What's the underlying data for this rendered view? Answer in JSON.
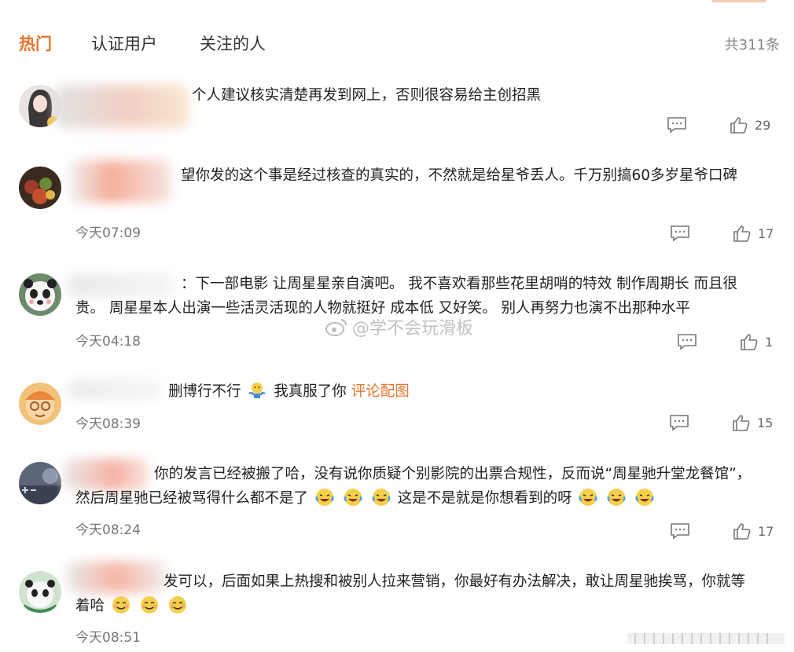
{
  "tabs": {
    "hot": "热门",
    "verified": "认证用户",
    "following": "关注的人",
    "total": "共311条"
  },
  "watermark": "@学不会玩滑板",
  "comments": [
    {
      "text": "个人建议核实清楚再发到网上，否则很容易给主创招黑",
      "time": "",
      "likes": "29"
    },
    {
      "text_line1": "望你发的这个事是经过核查的真实的，不然就是给星爷丢人。千万别搞60多岁星爷口碑",
      "time": "今天07:09",
      "likes": "17"
    },
    {
      "text_line1": "：下一部电影 让周星星亲自演吧。 我不喜欢看那些花里胡哨的特效 制作周期长 而且很",
      "text_line2": "贵。 周星星本人出演一些活灵活现的人物就挺好 成本低 又好笑。 别人再努力也演不出那种水平",
      "time": "今天04:18",
      "likes": "1"
    },
    {
      "text_a": "删博行不行",
      "text_b": "我真服了你",
      "link": "评论配图",
      "time": "今天08:39",
      "likes": "15"
    },
    {
      "text_line1": "你的发言已经被搬了哈，没有说你质疑个别影院的出票合规性，反而说“周星驰升堂龙餐馆”，",
      "text_line2": "然后周星驰已经被骂得什么都不是了",
      "text_line2b": "这是不是就是你想看到的呀",
      "time": "今天08:24",
      "likes": "17"
    },
    {
      "text_line1": "发可以，后面如果上热搜和被别人拉来营销，你最好有办法解决，敢让周星驰挨骂，你就等",
      "text_line2": "着哈",
      "time": "今天08:51"
    }
  ]
}
